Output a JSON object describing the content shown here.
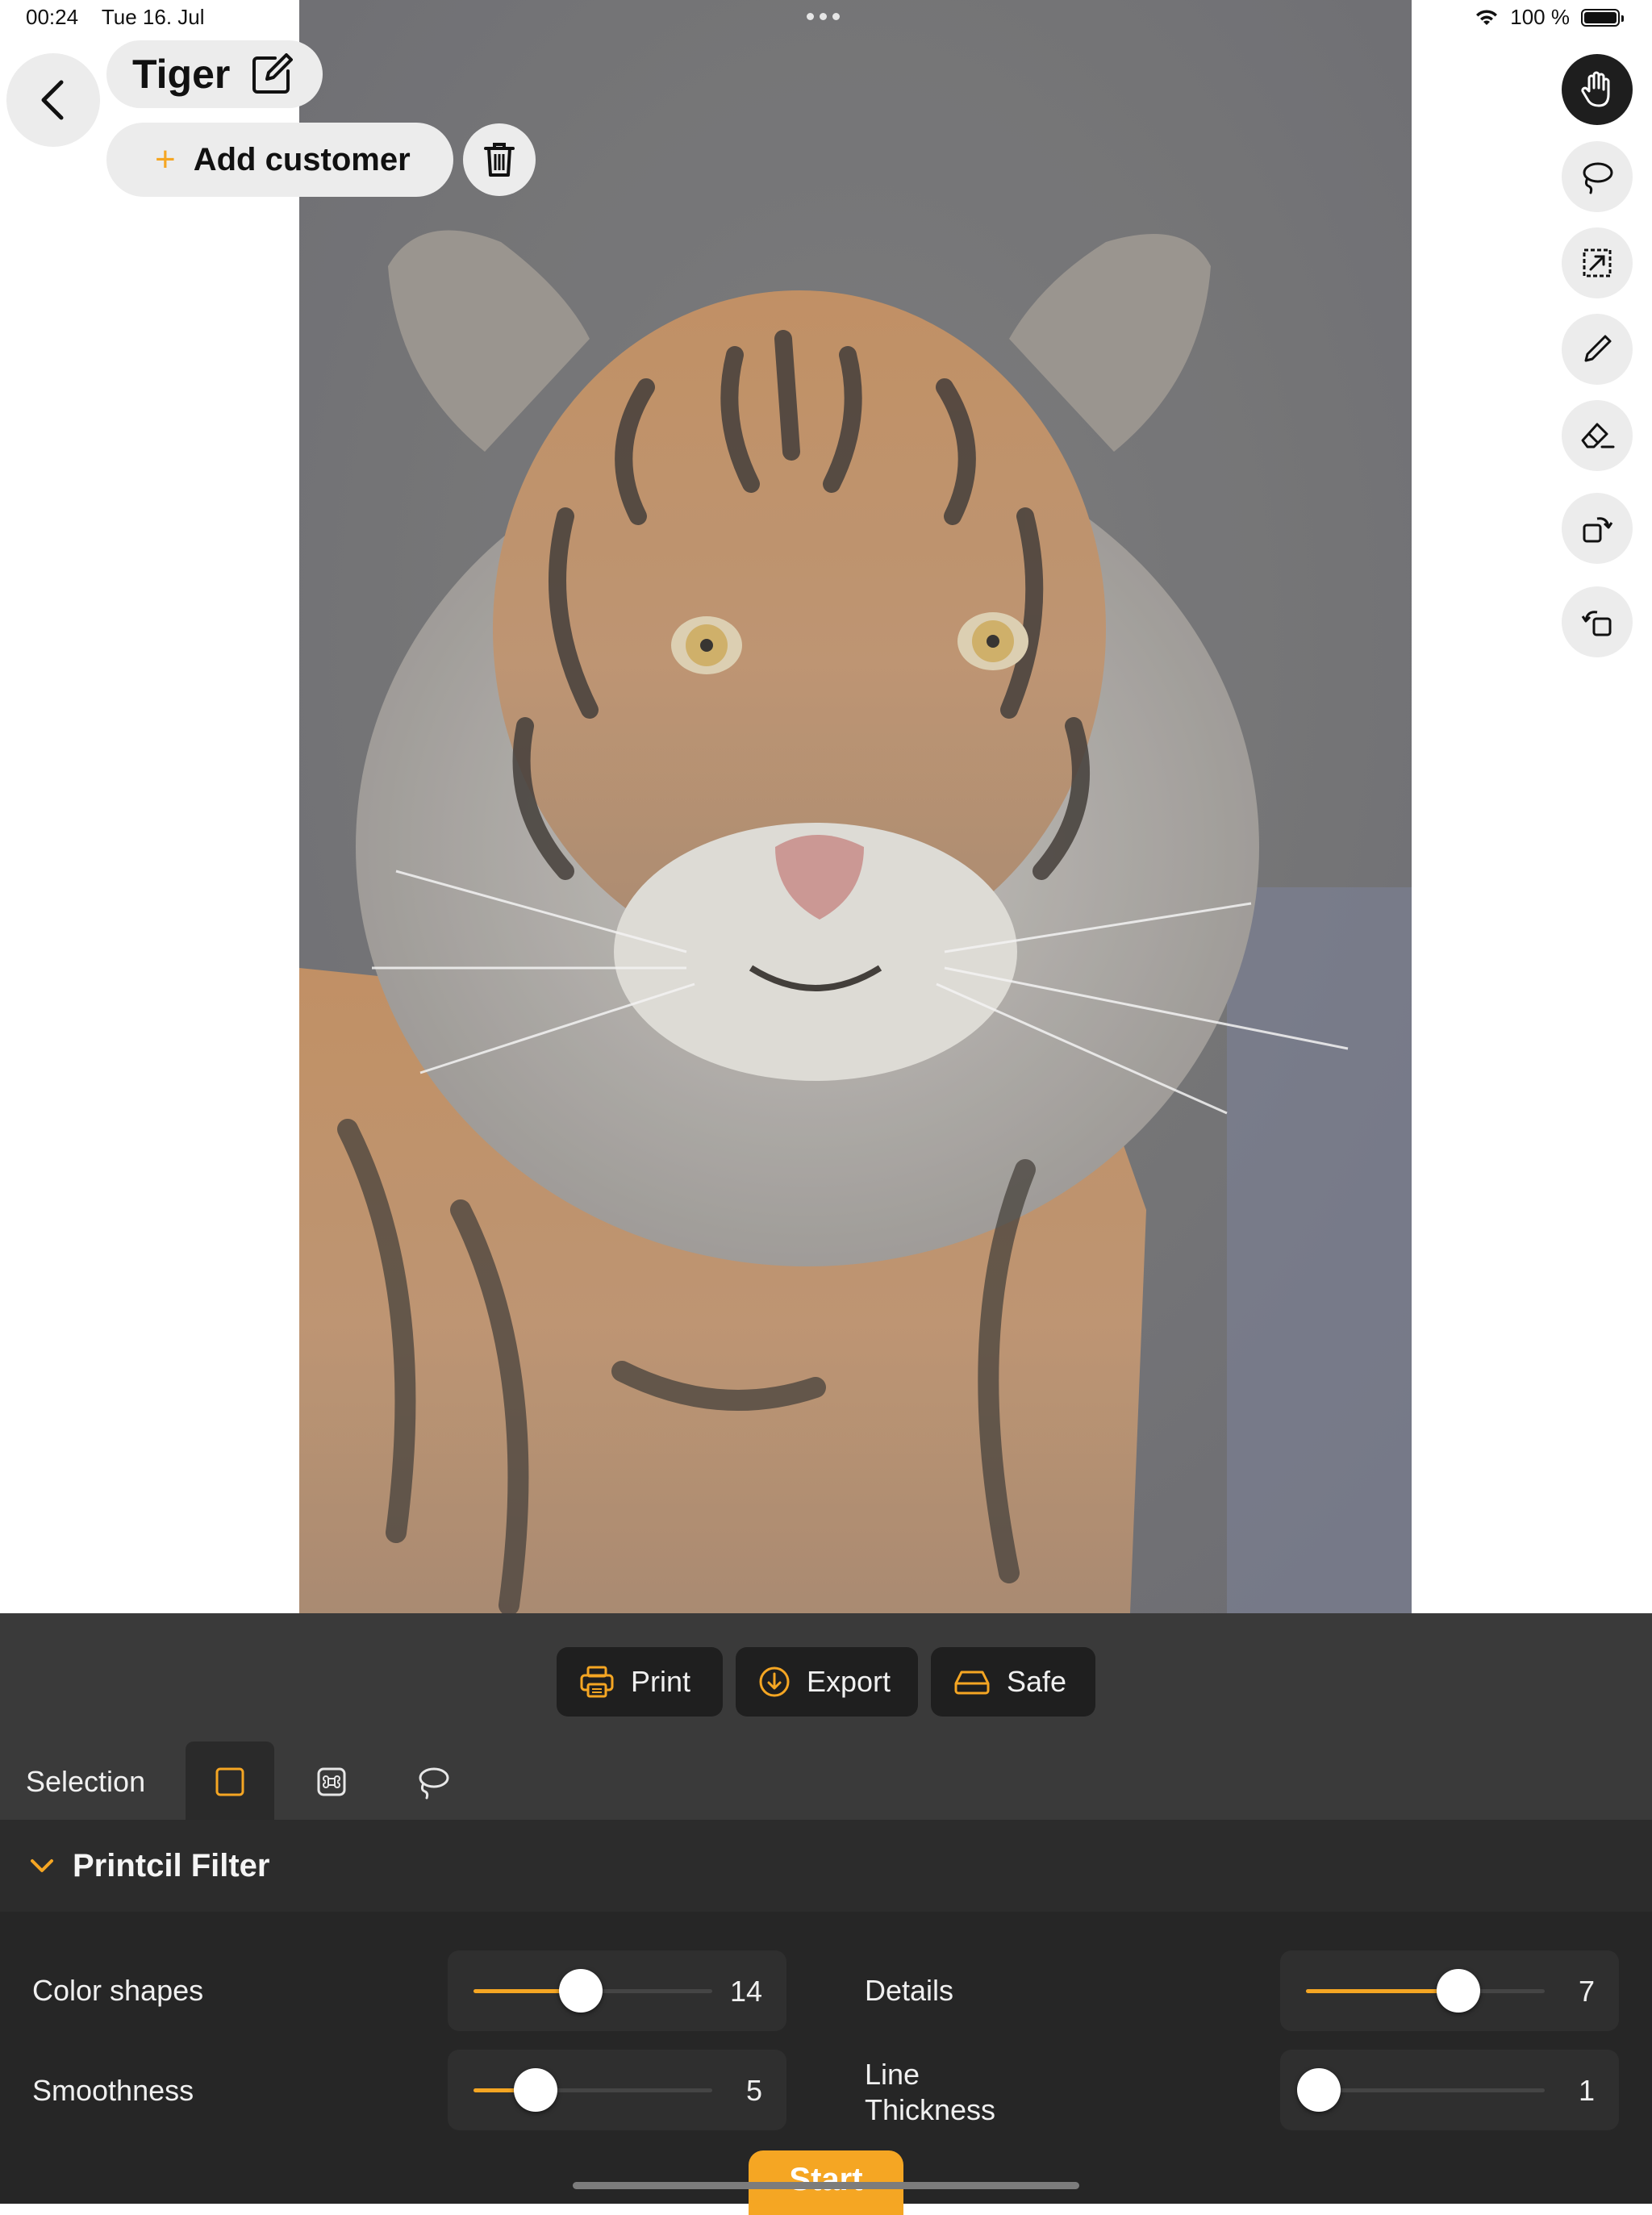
{
  "status_bar": {
    "time": "00:24",
    "date": "Tue 16. Jul",
    "battery": "100 %",
    "battery_level": 1.0
  },
  "document": {
    "title": "Tiger",
    "add_customer_label": "Add customer"
  },
  "icons": {
    "back": "chevron-left-icon",
    "edit": "edit-icon",
    "add": "plus-icon",
    "delete": "trash-icon",
    "tools": [
      "hand-icon",
      "lasso-icon",
      "resize-icon",
      "pencil-icon",
      "eraser-icon",
      "rotate-right-icon",
      "rotate-left-icon"
    ]
  },
  "actions": {
    "print": "Print",
    "export": "Export",
    "safe": "Safe"
  },
  "selection": {
    "label": "Selection",
    "modes": [
      "rectangle",
      "command",
      "lasso"
    ],
    "active": "rectangle"
  },
  "filter": {
    "title": "Printcil Filter",
    "color_shapes": {
      "label": "Color shapes",
      "value": "14",
      "fraction": 0.45
    },
    "details": {
      "label": "Details",
      "value": "7",
      "fraction": 0.64
    },
    "smoothness": {
      "label": "Smoothness",
      "value": "5",
      "fraction": 0.26
    },
    "line_thickness": {
      "label": "Line\nThickness",
      "value": "1",
      "fraction": 0.0
    }
  },
  "start_label": "Start",
  "colors": {
    "accent": "#f5a623",
    "panel": "#3a3a3a",
    "pill": "#ececec"
  }
}
